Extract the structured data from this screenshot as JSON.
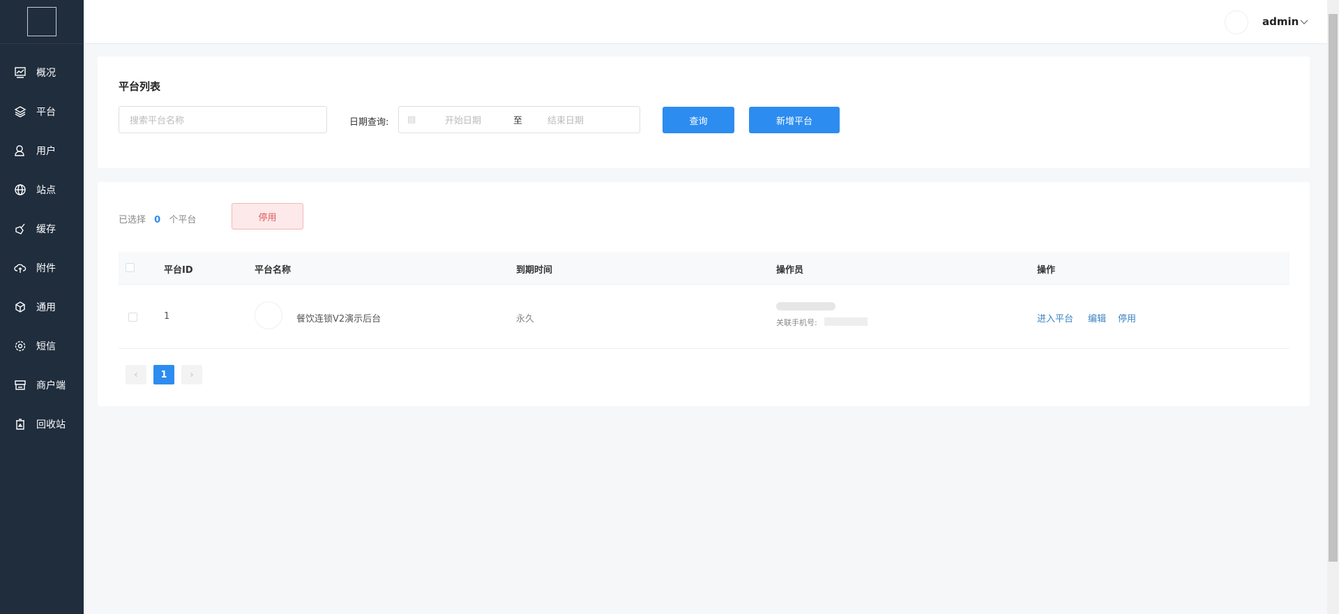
{
  "header": {
    "username": "admin"
  },
  "sidebar": {
    "items": [
      {
        "label": "概况",
        "icon": "chart-line-icon"
      },
      {
        "label": "平台",
        "icon": "layers-icon"
      },
      {
        "label": "用户",
        "icon": "user-icon"
      },
      {
        "label": "站点",
        "icon": "globe-icon"
      },
      {
        "label": "缓存",
        "icon": "broom-icon"
      },
      {
        "label": "附件",
        "icon": "cloud-upload-icon"
      },
      {
        "label": "通用",
        "icon": "cube-icon"
      },
      {
        "label": "短信",
        "icon": "gear-icon"
      },
      {
        "label": "商户端",
        "icon": "store-icon"
      },
      {
        "label": "回收站",
        "icon": "trash-icon"
      }
    ]
  },
  "filter": {
    "title": "平台列表",
    "search_placeholder": "搜索平台名称",
    "date_label": "日期查询:",
    "start_placeholder": "开始日期",
    "separator": "至",
    "end_placeholder": "结束日期",
    "query_label": "查询",
    "add_label": "新增平台"
  },
  "list": {
    "selected_prefix": "已选择",
    "selected_count": "0",
    "selected_suffix": "个平台",
    "disable_label": "停用",
    "columns": [
      "平台ID",
      "平台名称",
      "到期时间",
      "操作员",
      "操作"
    ],
    "rows": [
      {
        "id": "1",
        "name": "餐饮连锁V2演示后台",
        "expiry": "永久",
        "operator_phone_label": "关联手机号:",
        "actions": [
          "进入平台",
          "编辑",
          "停用"
        ]
      }
    ]
  },
  "pagination": {
    "current": "1",
    "prev": "‹",
    "next": "›"
  },
  "colors": {
    "primary": "#2d8cf0",
    "sidebar": "#1f2d3d",
    "danger_bg": "#fde9ea",
    "danger_text": "#e05a5a"
  }
}
